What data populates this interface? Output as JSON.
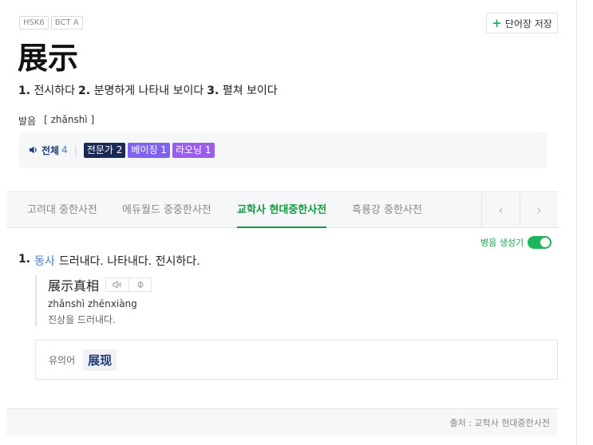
{
  "badges": [
    "HSK6",
    "BCT A"
  ],
  "save_button": {
    "label": "단어장 저장"
  },
  "headword": "展示",
  "meanings": [
    {
      "num": "1.",
      "text": "전시하다"
    },
    {
      "num": "2.",
      "text": "분명하게 나타내 보이다"
    },
    {
      "num": "3.",
      "text": "펼쳐 보이다"
    }
  ],
  "pronunciation": {
    "label": "발음",
    "value": "[ zhǎnshì ]"
  },
  "audio": {
    "all_label": "전체",
    "all_count": "4",
    "separator": "|",
    "chips": [
      {
        "label": "전문가 2",
        "color": "#1b2a55"
      },
      {
        "label": "베이징 1",
        "color": "#8062f0"
      },
      {
        "label": "라오닝 1",
        "color": "#9b5cf0"
      }
    ]
  },
  "tabs": [
    {
      "label": "고려대 중한사전",
      "active": false
    },
    {
      "label": "에듀월드 중중한사전",
      "active": false
    },
    {
      "label": "교학사 현대중한사전",
      "active": true
    },
    {
      "label": "흑룡강 중한사전",
      "active": false
    }
  ],
  "tab_arrows": {
    "prev": "‹",
    "next": "›"
  },
  "pinyin_toggle": {
    "label": "병음 생성기",
    "on": true
  },
  "definition": {
    "num": "1.",
    "pos": "동사",
    "text": "드러내다. 나타내다. 전시하다."
  },
  "example": {
    "chinese": "展示真相",
    "pinyin": "zhǎnshì zhēnxiàng",
    "korean": "진상을 드러내다."
  },
  "synonym": {
    "label": "유의어",
    "word": "展现"
  },
  "footer": {
    "source": "출처 : 교학사 현대중한사전"
  },
  "colors": {
    "accent_green": "#1fb35b",
    "active_tab": "#0f9a3f",
    "link_blue": "#4a78c9",
    "navy": "#1d3a7a"
  }
}
